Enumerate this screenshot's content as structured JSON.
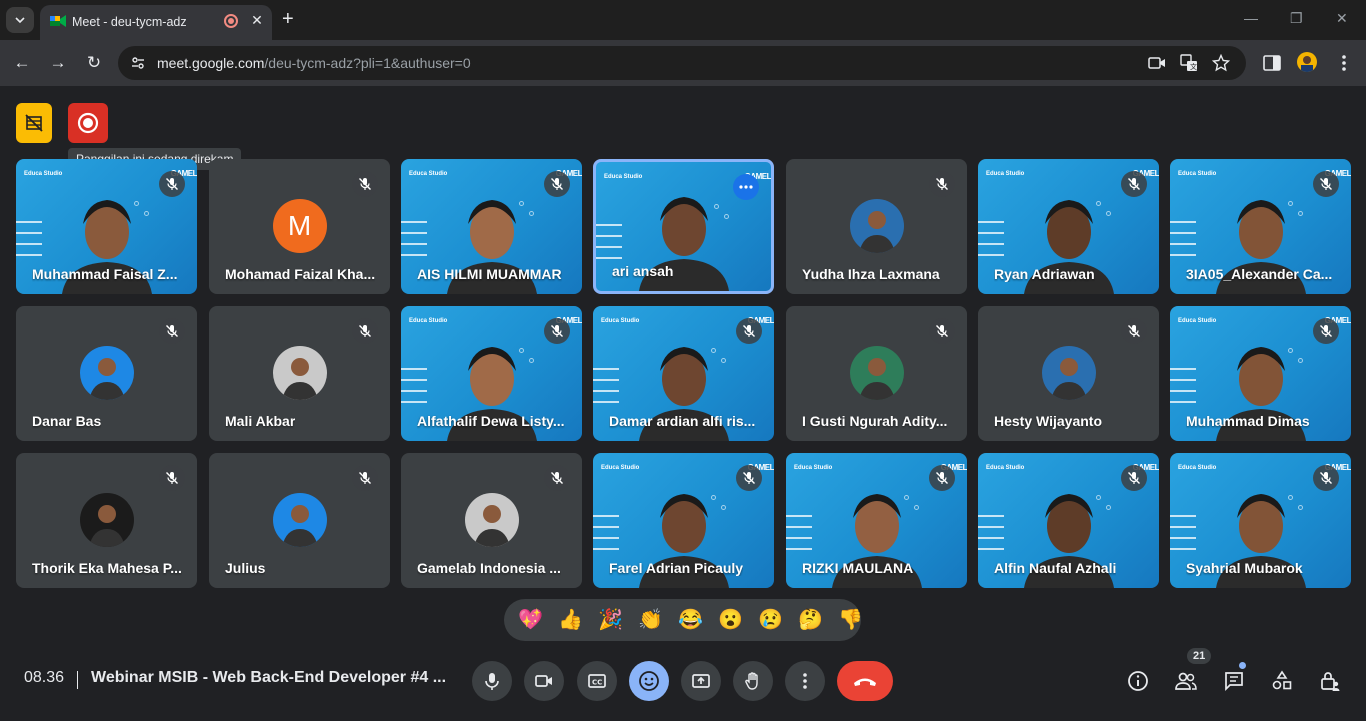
{
  "browser": {
    "tab_title": "Meet - deu-tycm-adz",
    "url_host": "meet.google.com",
    "url_path": "/deu-tycm-adz?pli=1&authuser=0"
  },
  "meet": {
    "recording_tooltip": "Panggilan ini sedang direkam",
    "participants": [
      {
        "name": "Muhammad Faisal Z...",
        "type": "video"
      },
      {
        "name": "Mohamad Faizal Kha...",
        "type": "letter",
        "letter": "M"
      },
      {
        "name": "AIS HILMI MUAMMAR",
        "type": "video"
      },
      {
        "name": "ari ansah",
        "type": "video"
      },
      {
        "name": "Yudha Ihza Laxmana",
        "type": "photo"
      },
      {
        "name": "Ryan Adriawan",
        "type": "video"
      },
      {
        "name": "3IA05_Alexander Ca...",
        "type": "video"
      },
      {
        "name": "Danar Bas",
        "type": "photo"
      },
      {
        "name": "Mali Akbar",
        "type": "photo"
      },
      {
        "name": "Alfathalif Dewa Listy...",
        "type": "video"
      },
      {
        "name": "Damar ardian alfi ris...",
        "type": "video"
      },
      {
        "name": "I Gusti Ngurah Adity...",
        "type": "photo"
      },
      {
        "name": "Hesty Wijayanto",
        "type": "photo"
      },
      {
        "name": "Muhammad Dimas",
        "type": "video"
      },
      {
        "name": "Thorik Eka Mahesa P...",
        "type": "photo"
      },
      {
        "name": "Julius",
        "type": "photo"
      },
      {
        "name": "Gamelab Indonesia ...",
        "type": "photo"
      },
      {
        "name": "Farel Adrian Picauly",
        "type": "video"
      },
      {
        "name": "RIZKI MAULANA",
        "type": "video"
      },
      {
        "name": "Alfin Naufal Azhali",
        "type": "video"
      },
      {
        "name": "Syahrial Mubarok",
        "type": "video"
      }
    ],
    "reactions": [
      "💖",
      "👍",
      "🎉",
      "👏",
      "😂",
      "😮",
      "😢",
      "🤔",
      "👎"
    ]
  },
  "bottom_bar": {
    "time": "08.36",
    "meeting_title": "Webinar MSIB - Web Back-End Developer #4 ...",
    "people_count": "21"
  }
}
